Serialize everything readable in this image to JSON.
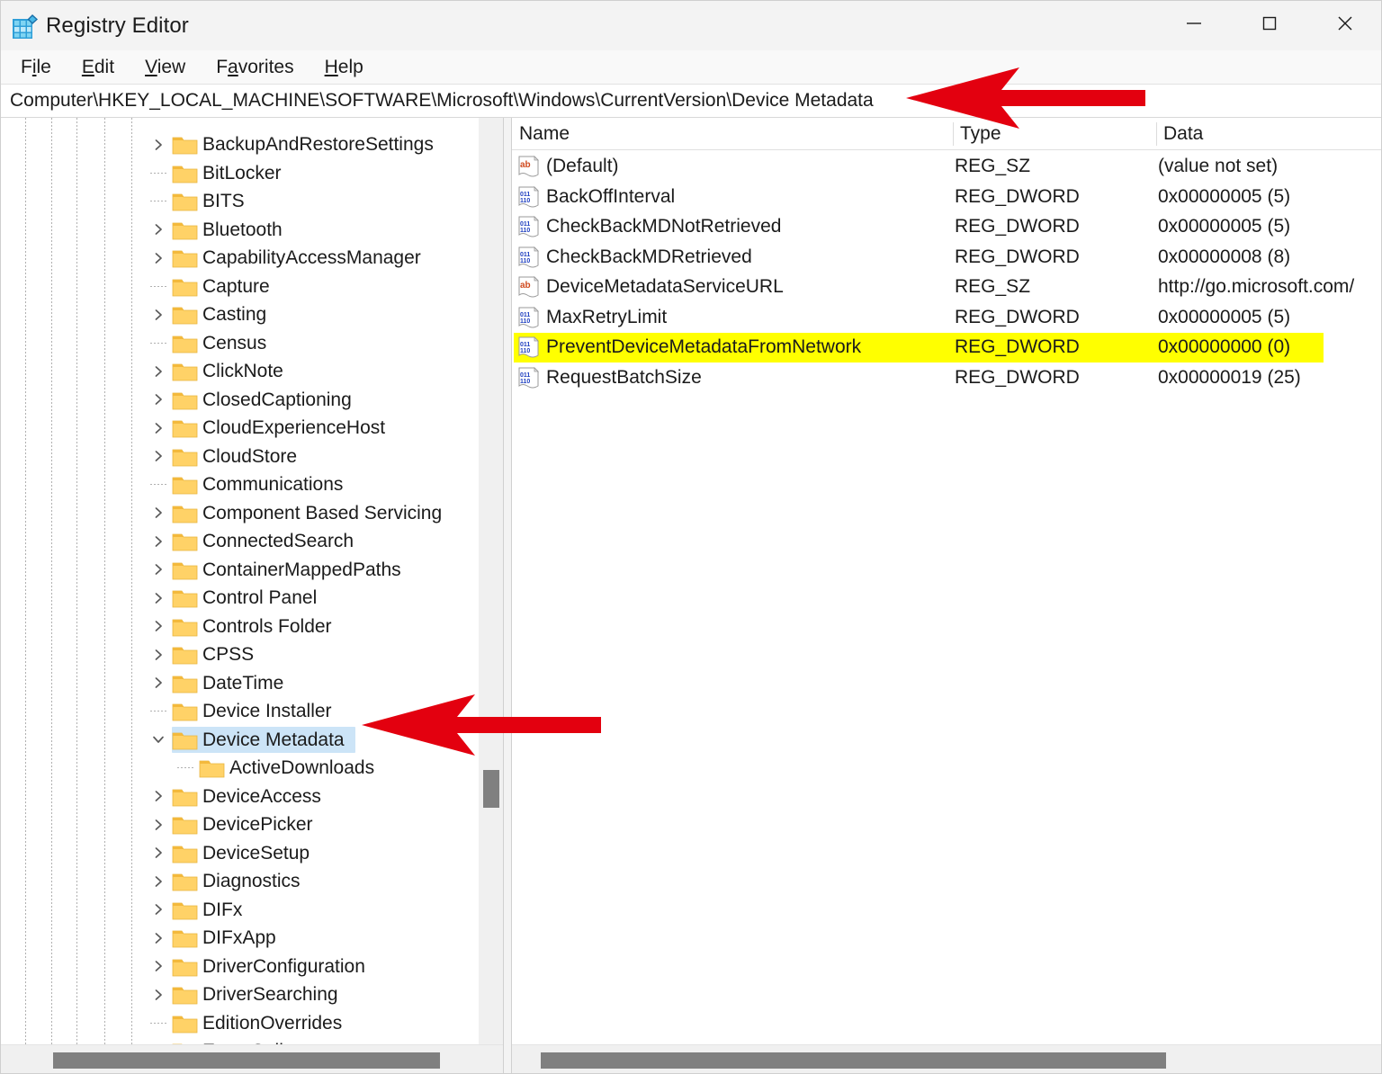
{
  "window": {
    "title": "Registry Editor",
    "icon": "registry-editor-icon",
    "controls": {
      "minimize": "minimize-icon",
      "maximize": "maximize-icon",
      "close": "close-icon"
    }
  },
  "menubar": {
    "items": [
      {
        "label": "File",
        "pre": "F",
        "key": "i",
        "post": "le"
      },
      {
        "label": "Edit",
        "pre": "",
        "key": "E",
        "post": "dit"
      },
      {
        "label": "View",
        "pre": "",
        "key": "V",
        "post": "iew"
      },
      {
        "label": "Favorites",
        "pre": "F",
        "key": "a",
        "post": "vorites"
      },
      {
        "label": "Help",
        "pre": "",
        "key": "H",
        "post": "elp"
      }
    ]
  },
  "address": {
    "path": "Computer\\HKEY_LOCAL_MACHINE\\SOFTWARE\\Microsoft\\Windows\\CurrentVersion\\Device Metadata"
  },
  "tree": {
    "items": [
      {
        "label": "BackupAndRestoreSettings",
        "expandable": true,
        "expanded": false,
        "selected": false,
        "child": false
      },
      {
        "label": "BitLocker",
        "expandable": false,
        "expanded": false,
        "selected": false,
        "child": false
      },
      {
        "label": "BITS",
        "expandable": false,
        "expanded": false,
        "selected": false,
        "child": false
      },
      {
        "label": "Bluetooth",
        "expandable": true,
        "expanded": false,
        "selected": false,
        "child": false
      },
      {
        "label": "CapabilityAccessManager",
        "expandable": true,
        "expanded": false,
        "selected": false,
        "child": false
      },
      {
        "label": "Capture",
        "expandable": false,
        "expanded": false,
        "selected": false,
        "child": false
      },
      {
        "label": "Casting",
        "expandable": true,
        "expanded": false,
        "selected": false,
        "child": false
      },
      {
        "label": "Census",
        "expandable": false,
        "expanded": false,
        "selected": false,
        "child": false
      },
      {
        "label": "ClickNote",
        "expandable": true,
        "expanded": false,
        "selected": false,
        "child": false
      },
      {
        "label": "ClosedCaptioning",
        "expandable": true,
        "expanded": false,
        "selected": false,
        "child": false
      },
      {
        "label": "CloudExperienceHost",
        "expandable": true,
        "expanded": false,
        "selected": false,
        "child": false
      },
      {
        "label": "CloudStore",
        "expandable": true,
        "expanded": false,
        "selected": false,
        "child": false
      },
      {
        "label": "Communications",
        "expandable": false,
        "expanded": false,
        "selected": false,
        "child": false
      },
      {
        "label": "Component Based Servicing",
        "expandable": true,
        "expanded": false,
        "selected": false,
        "child": false
      },
      {
        "label": "ConnectedSearch",
        "expandable": true,
        "expanded": false,
        "selected": false,
        "child": false
      },
      {
        "label": "ContainerMappedPaths",
        "expandable": true,
        "expanded": false,
        "selected": false,
        "child": false
      },
      {
        "label": "Control Panel",
        "expandable": true,
        "expanded": false,
        "selected": false,
        "child": false
      },
      {
        "label": "Controls Folder",
        "expandable": true,
        "expanded": false,
        "selected": false,
        "child": false
      },
      {
        "label": "CPSS",
        "expandable": true,
        "expanded": false,
        "selected": false,
        "child": false
      },
      {
        "label": "DateTime",
        "expandable": true,
        "expanded": false,
        "selected": false,
        "child": false
      },
      {
        "label": "Device Installer",
        "expandable": false,
        "expanded": false,
        "selected": false,
        "child": false
      },
      {
        "label": "Device Metadata",
        "expandable": true,
        "expanded": true,
        "selected": true,
        "child": false
      },
      {
        "label": "ActiveDownloads",
        "expandable": false,
        "expanded": false,
        "selected": false,
        "child": true
      },
      {
        "label": "DeviceAccess",
        "expandable": true,
        "expanded": false,
        "selected": false,
        "child": false
      },
      {
        "label": "DevicePicker",
        "expandable": true,
        "expanded": false,
        "selected": false,
        "child": false
      },
      {
        "label": "DeviceSetup",
        "expandable": true,
        "expanded": false,
        "selected": false,
        "child": false
      },
      {
        "label": "Diagnostics",
        "expandable": true,
        "expanded": false,
        "selected": false,
        "child": false
      },
      {
        "label": "DIFx",
        "expandable": true,
        "expanded": false,
        "selected": false,
        "child": false
      },
      {
        "label": "DIFxApp",
        "expandable": true,
        "expanded": false,
        "selected": false,
        "child": false
      },
      {
        "label": "DriverConfiguration",
        "expandable": true,
        "expanded": false,
        "selected": false,
        "child": false
      },
      {
        "label": "DriverSearching",
        "expandable": true,
        "expanded": false,
        "selected": false,
        "child": false
      },
      {
        "label": "EditionOverrides",
        "expandable": false,
        "expanded": false,
        "selected": false,
        "child": false
      },
      {
        "label": "EventCollector",
        "expandable": true,
        "expanded": false,
        "selected": false,
        "child": false
      }
    ]
  },
  "values": {
    "columns": [
      "Name",
      "Type",
      "Data"
    ],
    "rows": [
      {
        "icon": "string-value-icon",
        "name": "(Default)",
        "type": "REG_SZ",
        "data": "(value not set)",
        "highlighted": false
      },
      {
        "icon": "dword-value-icon",
        "name": "BackOffInterval",
        "type": "REG_DWORD",
        "data": "0x00000005 (5)",
        "highlighted": false
      },
      {
        "icon": "dword-value-icon",
        "name": "CheckBackMDNotRetrieved",
        "type": "REG_DWORD",
        "data": "0x00000005 (5)",
        "highlighted": false
      },
      {
        "icon": "dword-value-icon",
        "name": "CheckBackMDRetrieved",
        "type": "REG_DWORD",
        "data": "0x00000008 (8)",
        "highlighted": false
      },
      {
        "icon": "string-value-icon",
        "name": "DeviceMetadataServiceURL",
        "type": "REG_SZ",
        "data": "http://go.microsoft.com/",
        "highlighted": false
      },
      {
        "icon": "dword-value-icon",
        "name": "MaxRetryLimit",
        "type": "REG_DWORD",
        "data": "0x00000005 (5)",
        "highlighted": false
      },
      {
        "icon": "dword-value-icon",
        "name": "PreventDeviceMetadataFromNetwork",
        "type": "REG_DWORD",
        "data": "0x00000000 (0)",
        "highlighted": true
      },
      {
        "icon": "dword-value-icon",
        "name": "RequestBatchSize",
        "type": "REG_DWORD",
        "data": "0x00000019 (25)",
        "highlighted": false
      }
    ]
  },
  "annotations": {
    "arrows": [
      {
        "name": "address-bar-arrow",
        "direction": "left"
      },
      {
        "name": "device-metadata-node-arrow",
        "direction": "left"
      }
    ],
    "highlight_color": "#ffff00",
    "arrow_color": "#e3000f"
  }
}
